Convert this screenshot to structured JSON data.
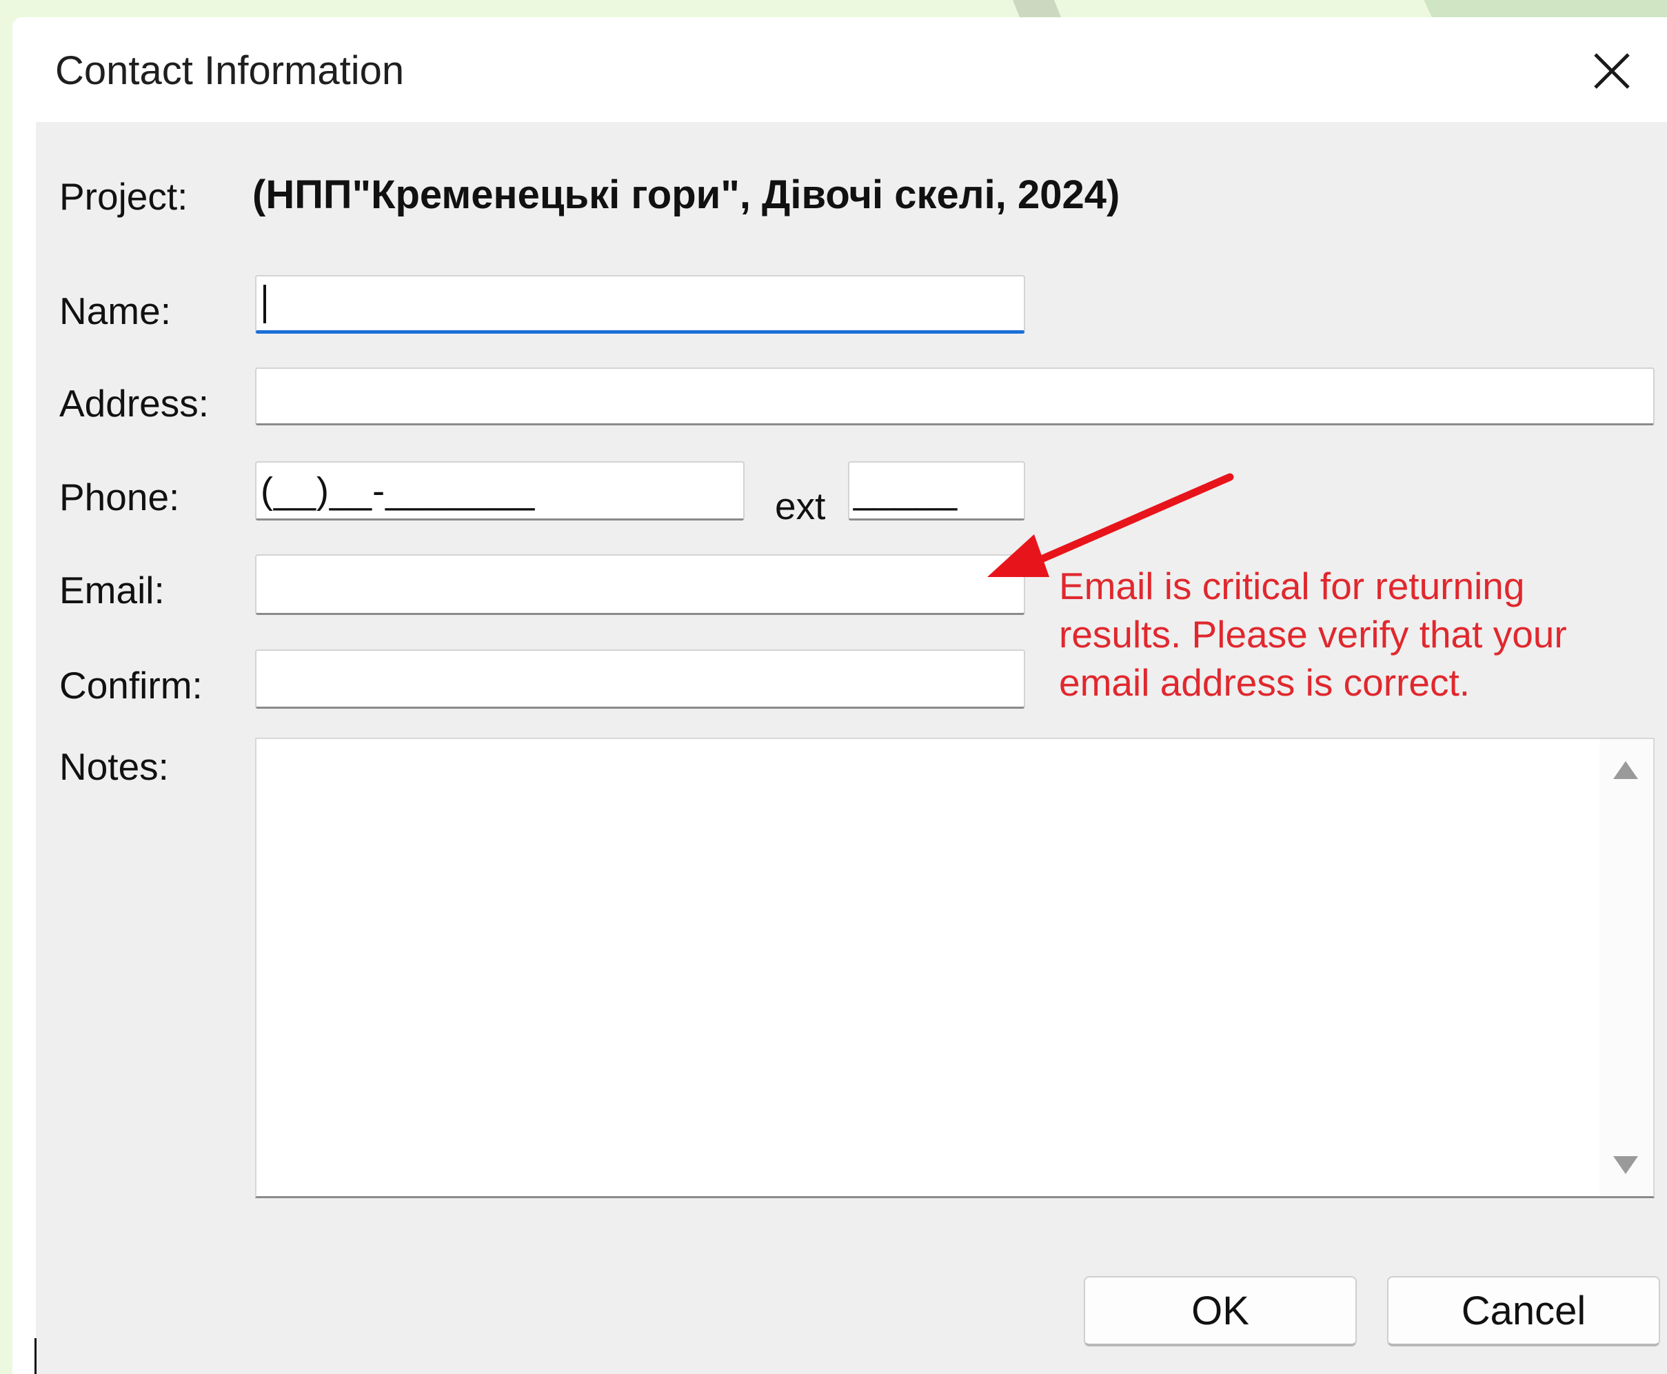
{
  "window": {
    "title": "Contact Information"
  },
  "form": {
    "project_label": "Project:",
    "project_value": "(НПП\"Кременецькі гори\", Дівочі скелі, 2024)",
    "name_label": "Name:",
    "name_value": "",
    "address_label": "Address:",
    "address_value": "",
    "phone_label": "Phone:",
    "phone_mask": "(__)__-_______",
    "ext_label": "ext",
    "ext_mask": "_____",
    "email_label": "Email:",
    "email_value": "",
    "confirm_label": "Confirm:",
    "confirm_value": "",
    "notes_label": "Notes:",
    "notes_value": ""
  },
  "annotation": {
    "text": "Email is critical for returning results. Please verify that your email address is correct.",
    "color": "#e0282e"
  },
  "buttons": {
    "ok": "OK",
    "cancel": "Cancel"
  },
  "icons": {
    "close": "close-icon",
    "scroll_up": "scroll-up-arrow-icon",
    "scroll_down": "scroll-down-arrow-icon",
    "annotation_arrow": "red-arrow-icon"
  }
}
